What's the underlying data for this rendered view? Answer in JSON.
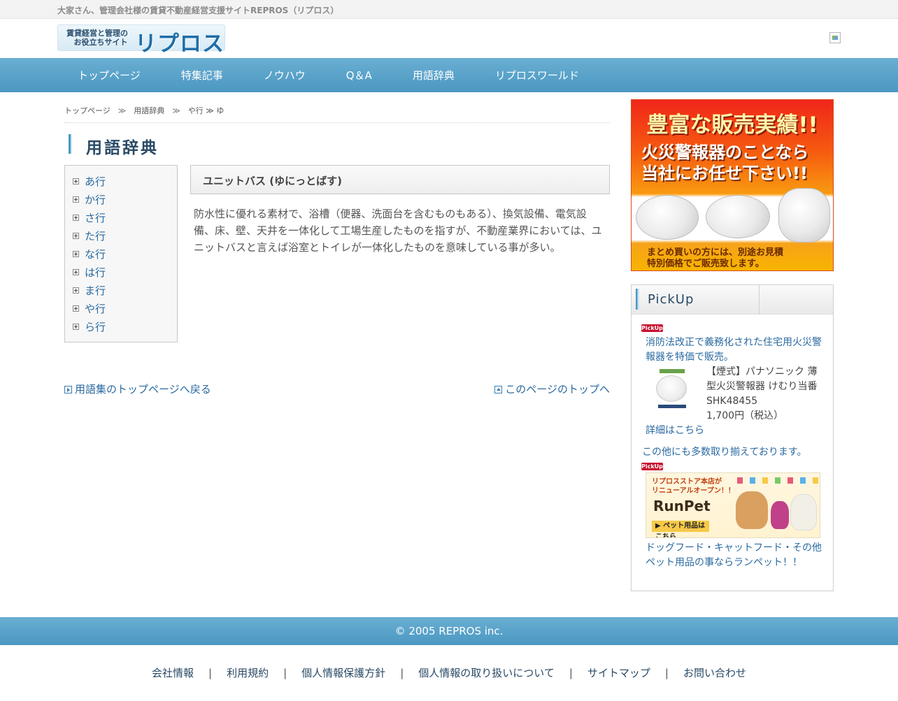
{
  "topbar": {
    "tagline": "大家さん、管理会社様の賃貸不動産経営支援サイトREPROS（リプロス）"
  },
  "logo": {
    "badge_line1": "賃貸経営と管理の",
    "badge_line2": "お役立ちサイト",
    "name": "リプロス"
  },
  "nav": {
    "items": [
      "トップページ",
      "特集記事",
      "ノウハウ",
      "Q＆A",
      "用語辞典",
      "リプロスワールド"
    ]
  },
  "breadcrumb": {
    "items": [
      "トップページ",
      "用語辞典",
      "や行 ≫ ゆ"
    ],
    "separator": "≫"
  },
  "page": {
    "title": "用語辞典"
  },
  "side_menu": {
    "items": [
      "あ行",
      "か行",
      "さ行",
      "た行",
      "な行",
      "は行",
      "ま行",
      "や行",
      "ら行"
    ]
  },
  "term": {
    "heading": "ユニットバス (ゆにっとばす)",
    "description": "防水性に優れる素材で、浴槽（便器、洗面台を含むものもある）、換気設備、電気設備、床、壁、天井を一体化して工場生産したものを指すが、不動産業界においては、ユニットバスと言えば浴室とトイレが一体化したものを意味している事が多い。"
  },
  "links": {
    "back": "用語集のトップページへ戻る",
    "top": "このページのトップへ"
  },
  "ad": {
    "title": "豊富な販売実績!!",
    "sub1": "火災警報器のことなら",
    "sub2": "当社にお任せ下さい!!",
    "foot1": "まとめ買いの方には、別途お見積",
    "foot2": "特別価格でご販売致します。"
  },
  "pickup": {
    "title": "PickUp",
    "badge": "PickUp!",
    "item1_link": "消防法改正で義務化された住宅用火災警報器を特価で販売。",
    "product_name": "【煙式】パナソニック 薄型火災警報器 けむり当番",
    "product_code": "SHK48455",
    "product_price": "1,700円（税込）",
    "details_link": "詳細はこちら",
    "more_text": "この他にも多数取り揃えております。",
    "runpet_top1": "リプロスストア本店が",
    "runpet_top2": "リニューアルオープン！！",
    "runpet_logo": "RunPet",
    "runpet_btn": "▶ ペット用品はこちら",
    "item2_link": "ドッグフード・キャットフード・その他ペット用品の事ならランペット！！"
  },
  "footer": {
    "copyright": "© 2005 REPROS inc.",
    "links": [
      "会社情報",
      "利用規約",
      "個人情報保護方針",
      "個人情報の取り扱いについて",
      "サイトマップ",
      "お問い合わせ"
    ]
  },
  "colors": {
    "nav": "#4b98c2",
    "link": "#2a6aa0",
    "heading": "#2a4a66"
  }
}
